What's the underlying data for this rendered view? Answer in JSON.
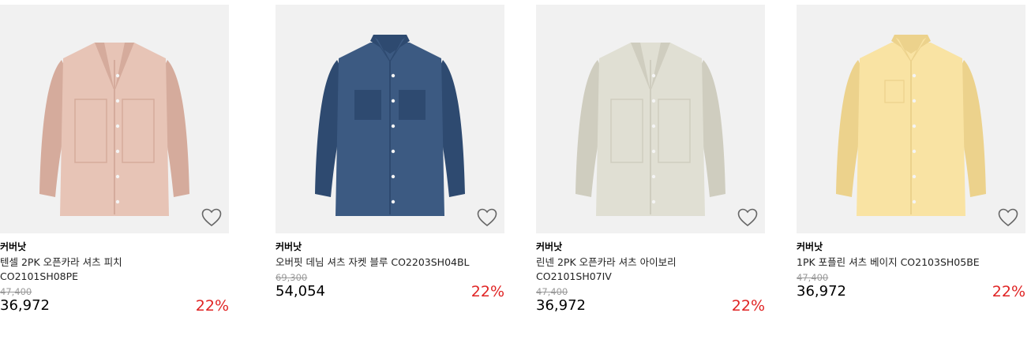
{
  "products": [
    {
      "brand": "커버낫",
      "name": "오버핏 데님 셔츠 자켓 블루 CO2203SH04BL",
      "original_price": "69,300",
      "sale_price": "54,054",
      "discount": "22%",
      "shirt_color": "#3c5a82",
      "shirt_shade": "#2e4a70",
      "style": "denim"
    },
    {
      "brand": "커버낫",
      "name": "린넨 2PK 오픈카라 셔츠 아이보리 CO2101SH07IV",
      "original_price": "47,400",
      "sale_price": "36,972",
      "discount": "22%",
      "shirt_color": "#e0dfd3",
      "shirt_shade": "#cfcdbf",
      "style": "open"
    },
    {
      "brand": "커버낫",
      "name": "1PK 포플린 셔츠 베이지 CO2103SH05BE",
      "original_price": "47,400",
      "sale_price": "36,972",
      "discount": "22%",
      "shirt_color": "#f9e3a3",
      "shirt_shade": "#ecd28c",
      "style": "button"
    },
    {
      "brand": "커버낫",
      "name": "텐셀 2PK 오픈카라 셔츠 피치 CO2101SH08PE",
      "original_price": "47,400",
      "sale_price": "36,972",
      "discount": "22%",
      "shirt_color": "#e7c4b6",
      "shirt_shade": "#d5ab9c",
      "style": "open"
    }
  ]
}
